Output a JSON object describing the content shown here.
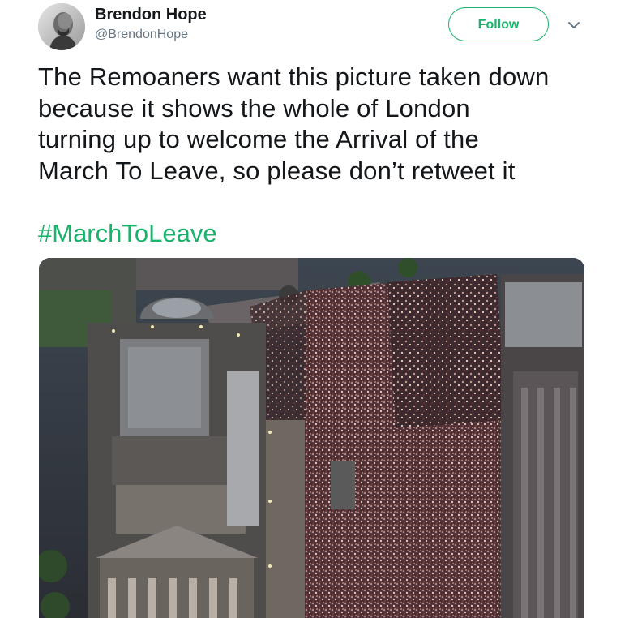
{
  "tweet": {
    "author": {
      "display_name": "Brendon Hope",
      "handle": "@BrendonHope",
      "avatar_icon": "avatar-photo"
    },
    "follow_label": "Follow",
    "caret_icon": "chevron-down-icon",
    "text_lines": [
      "The Remoaners want this picture taken down",
      "because it shows the whole of London",
      "turning up to welcome the Arrival of the",
      "March To Leave, so please don’t retweet it"
    ],
    "hashtag": "#MarchToLeave",
    "media": {
      "kind": "photo",
      "description_icon": "aerial-crowd-photo"
    }
  },
  "colors": {
    "accent": "#19b36b",
    "text": "#14171a",
    "secondary_text": "#657786",
    "background": "#ffffff"
  }
}
